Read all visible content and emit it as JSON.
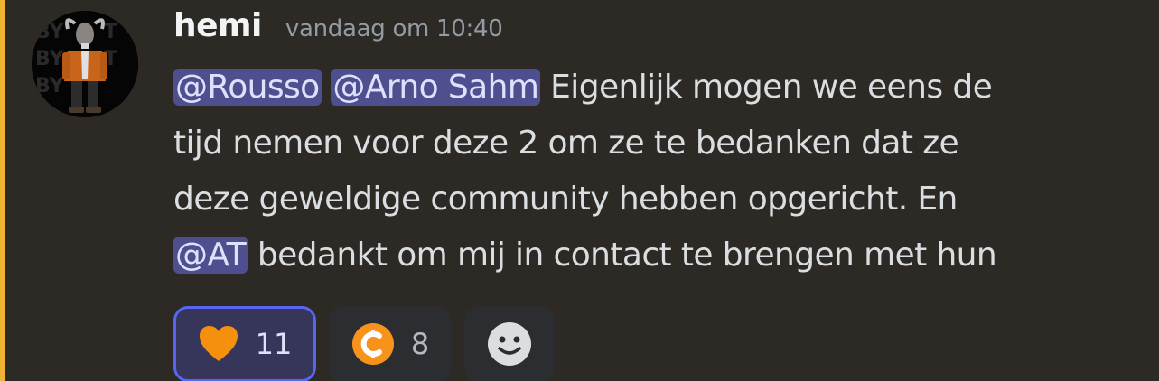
{
  "message": {
    "author": "hemi",
    "timestamp": "vandaag om 10:40",
    "lines": [
      {
        "mentions": [
          "@Rousso",
          "@Arno Sahm"
        ],
        "text": " Eigenlijk mogen we eens de"
      },
      {
        "text": "tijd nemen voor deze 2 om ze te bedanken dat ze"
      },
      {
        "text": "deze geweldige community hebben opgericht. En"
      },
      {
        "mention": "@AT",
        "text": " bedankt om mij in contact te brengen met hun"
      }
    ]
  },
  "reactions": [
    {
      "emoji": "orange-heart-icon",
      "count": "11",
      "active": true
    },
    {
      "emoji": "coin-icon",
      "count": "8",
      "active": false
    }
  ],
  "colors": {
    "background": "#2d2a26",
    "mention_highlight": "#f0b232",
    "mention_bg": "#4e4f8f",
    "active_reaction_border": "#5865f2"
  }
}
